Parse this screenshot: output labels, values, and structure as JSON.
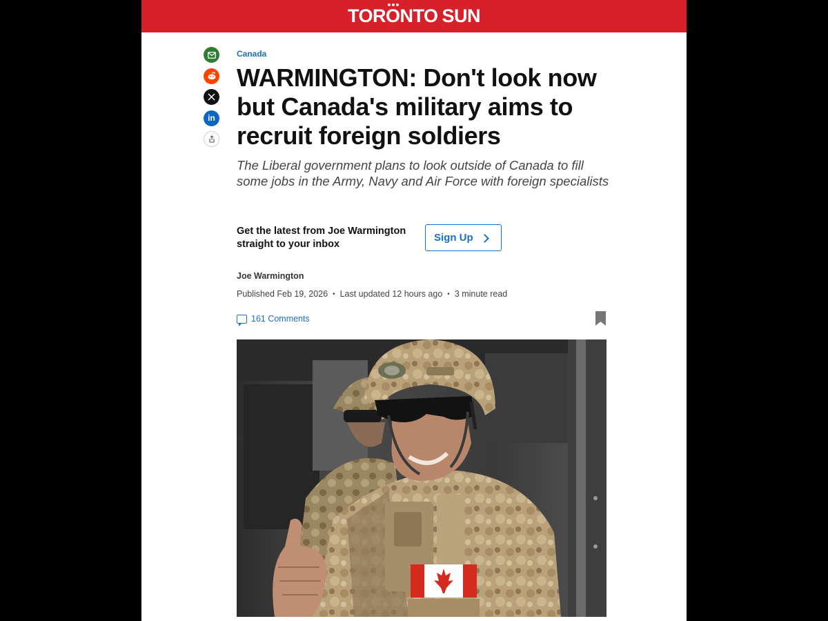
{
  "masthead": {
    "brand_part1": "TORONTO",
    "brand_part2": "SUN",
    "color": "#d6202a"
  },
  "share": {
    "icons": [
      "email-icon",
      "reddit-icon",
      "x-icon",
      "linkedin-icon",
      "share-icon"
    ],
    "linkedin_label": "in"
  },
  "article": {
    "category": "Canada",
    "headline": "WARMINGTON: Don't look now but Canada's military aims to recruit foreign soldiers",
    "dek": "The Liberal government plans to look outside of Canada to fill some jobs in the Army, Navy and Air Force with foreign specialists",
    "newsletter_text": "Get the latest from Joe Warmington straight to your inbox",
    "signup_label": "Sign Up",
    "author": "Joe Warmington",
    "published": "Published Feb 19, 2026",
    "updated": "Last updated 12 hours ago",
    "read_time": "3 minute read",
    "comments": "161 Comments",
    "separator": "•"
  },
  "colors": {
    "accent": "#1a6fc6",
    "text": "#111111"
  }
}
